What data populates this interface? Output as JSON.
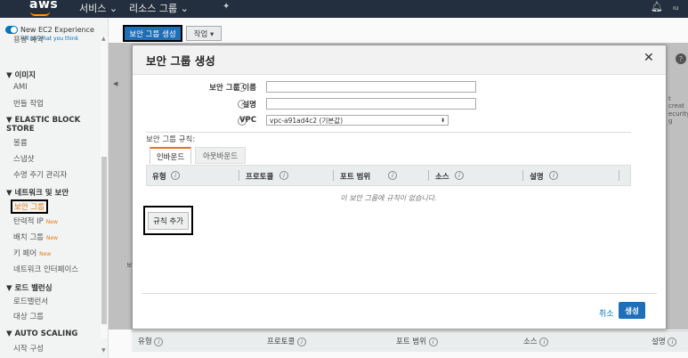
{
  "topnav": {
    "logo": "aws",
    "services": "서비스",
    "resource_groups": "리소스 그룹",
    "user": "ıu"
  },
  "sidebar": {
    "experience_title": "New EC2 Experience",
    "experience_sub": "Tell us what you think",
    "items": [
      {
        "label": "용량 예약",
        "type": "item"
      },
      {
        "label": "▼ 이미지",
        "type": "head"
      },
      {
        "label": "AMI",
        "type": "item"
      },
      {
        "label": "번들 작업",
        "type": "item"
      },
      {
        "label": "▼ ELASTIC BLOCK",
        "type": "head"
      },
      {
        "label": "STORE",
        "type": "head"
      },
      {
        "label": "볼륨",
        "type": "item"
      },
      {
        "label": "스냅샷",
        "type": "item"
      },
      {
        "label": "수명 주기 관리자",
        "type": "item"
      },
      {
        "label": "▼ 네트워크 및 보안",
        "type": "head"
      },
      {
        "label": "보안 그룹",
        "type": "selected"
      },
      {
        "label": "탄력적 IP",
        "badge": "New",
        "type": "item"
      },
      {
        "label": "배치 그룹",
        "badge": "New",
        "type": "item"
      },
      {
        "label": "키 페어",
        "badge": "New",
        "type": "item"
      },
      {
        "label": "네트워크 인터페이스",
        "type": "item"
      },
      {
        "label": "▼ 로드 밸런싱",
        "type": "head"
      },
      {
        "label": "로드밸런서",
        "type": "item"
      },
      {
        "label": "대상 그룹",
        "type": "item"
      },
      {
        "label": "▼ AUTO SCALING",
        "type": "head"
      },
      {
        "label": "시작 구성",
        "type": "item"
      }
    ]
  },
  "main": {
    "create_sg_button": "보안 그룹 생성",
    "actions_button": "작업 ▾",
    "peek_right_1": "t creat",
    "peek_right_2": "ecurity g",
    "peek_left": "보",
    "bottom_columns": [
      "유형",
      "프로토콜",
      "포트 범위",
      "소스",
      "설명"
    ]
  },
  "modal": {
    "title": "보안 그룹 생성",
    "close": "✕",
    "name_label": "보안 그룹 이름",
    "desc_label": "설명",
    "vpc_label": "VPC",
    "name_value": "",
    "desc_value": "",
    "vpc_value": "vpc-a91ad4c2 (기본값)",
    "rules_label": "보안 그룹 규칙:",
    "tab_inbound": "인바운드",
    "tab_outbound": "아웃바운드",
    "columns": [
      "유형",
      "프로토콜",
      "포트 범위",
      "소스",
      "설명"
    ],
    "empty_message": "이 보안 그룹에 규칙이 없습니다.",
    "add_rule": "규칙 추가",
    "cancel": "취소",
    "create": "생성"
  }
}
